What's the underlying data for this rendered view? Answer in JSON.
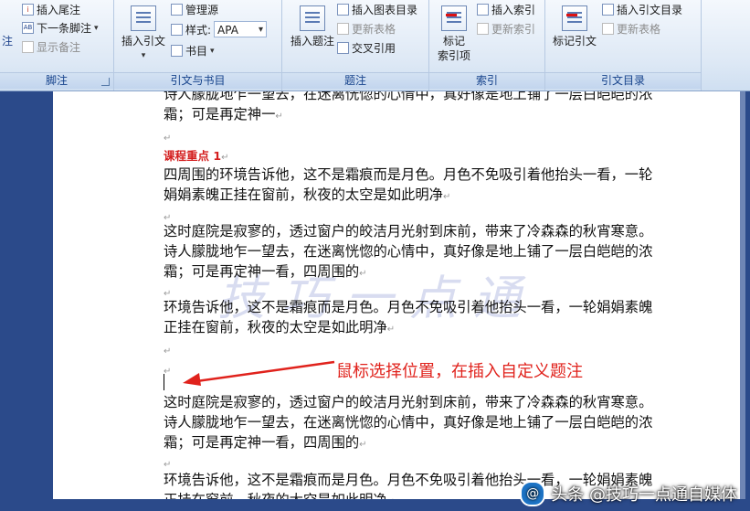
{
  "ribbon": {
    "footnotes": {
      "label": "脚注",
      "insert_endnote": "插入尾注",
      "next_footnote": "下一条脚注",
      "show_notes": "显示备注"
    },
    "citations": {
      "label": "引文与书目",
      "insert_citation": "插入引文",
      "manage_sources": "管理源",
      "style_label": "样式:",
      "style_value": "APA",
      "bibliography": "书目"
    },
    "captions": {
      "label": "题注",
      "insert_caption": "插入题注",
      "insert_table_of_figures": "插入图表目录",
      "update_table": "更新表格",
      "cross_reference": "交叉引用"
    },
    "index": {
      "label": "索引",
      "mark_entry": "标记\n索引项",
      "insert_index": "插入索引",
      "update_index": "更新索引"
    },
    "table_of_authorities": {
      "label": "引文目录",
      "mark_citation": "标记引文",
      "insert_toa": "插入引文目录",
      "update_table": "更新表格"
    }
  },
  "document": {
    "line1": "诗人朦胧地乍一望去，在迷离恍惚的心情中，真好像是地上铺了一层白皑皑的浓",
    "line2": "霜；可是再定神一",
    "heading": "课程重点 1",
    "p1_l1": "四周围的环境告诉他，这不是霜痕而是月色。月色不免吸引着他抬头一看，一轮",
    "p1_l2": "娟娟素魄正挂在窗前，秋夜的太空是如此明净",
    "p2_l1": "这时庭院是寂寥的，透过窗户的皎洁月光射到床前，带来了冷森森的秋宵寒意。",
    "p2_l2": "诗人朦胧地乍一望去，在迷离恍惚的心情中，真好像是地上铺了一层白皑皑的浓",
    "p2_l3": "霜；可是再定神一看，四周围的",
    "p3_l1": "环境告诉他，这不是霜痕而是月色。月色不免吸引着他抬头一看，一轮娟娟素魄",
    "p3_l2": "正挂在窗前，秋夜的太空是如此明净",
    "p4_l1": "这时庭院是寂寥的，透过窗户的皎洁月光射到床前，带来了冷森森的秋宵寒意。",
    "p4_l2": "诗人朦胧地乍一望去，在迷离恍惚的心情中，真好像是地上铺了一层白皑皑的浓",
    "p4_l3": "霜；可是再定神一看，四周围的",
    "p5_l1": "环境告诉他，这不是霜痕而是月色。月色不免吸引着他抬头一看，一轮娟娟素魄",
    "p5_l2": "正挂在窗前，秋夜的太空是如此明净",
    "para_mark": "↵",
    "annotation": "鼠标选择位置，在插入自定义题注",
    "watermark": "技巧一点通"
  },
  "badge": {
    "text": "头条 @技巧一点通自媒体"
  },
  "colors": {
    "annotation": "#e0221c",
    "heading": "#d41f1f",
    "ribbon_label": "#15428b"
  }
}
